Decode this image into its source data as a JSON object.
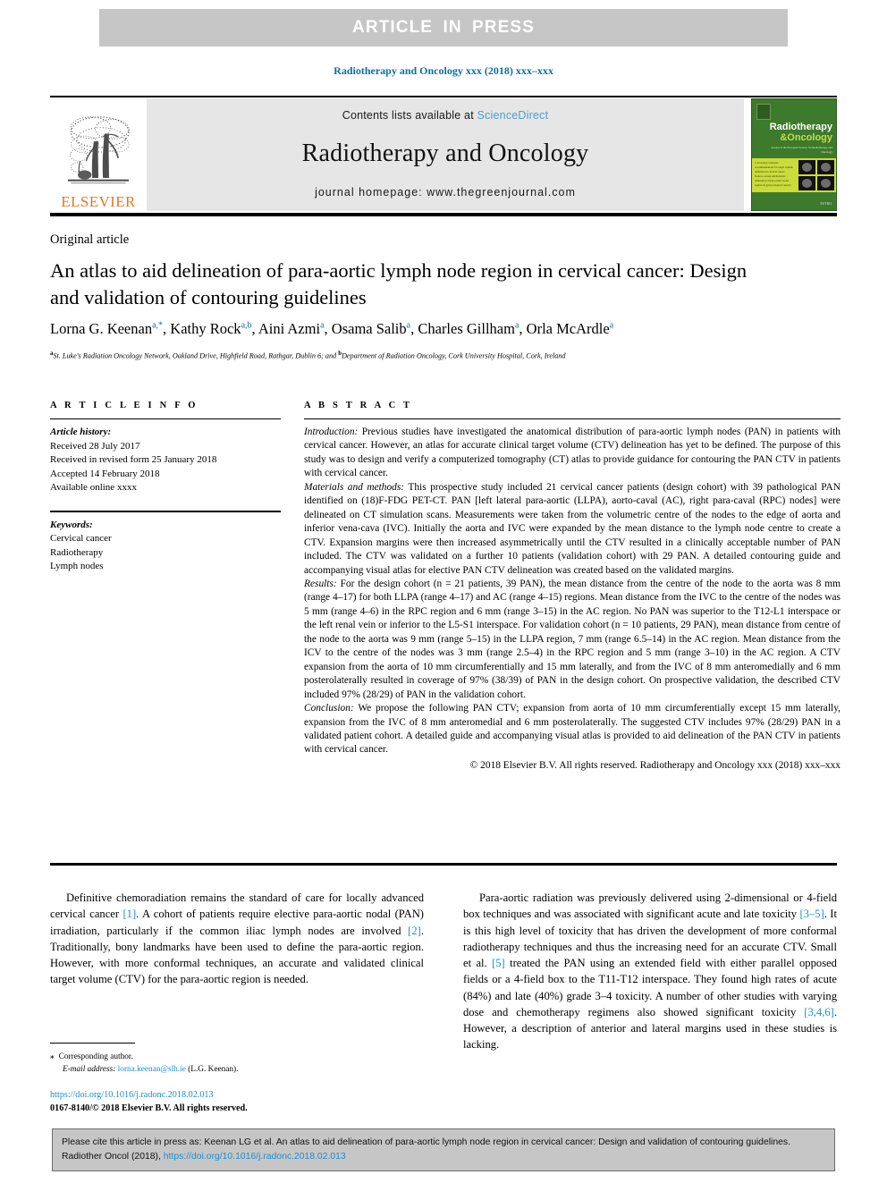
{
  "banner": {
    "text": "ARTICLE IN PRESS"
  },
  "journal_ref": "Radiotherapy and Oncology xxx (2018) xxx–xxx",
  "masthead": {
    "contents_prefix": "Contents lists available at ",
    "sciencedirect": "ScienceDirect",
    "journal_title": "Radiotherapy and Oncology",
    "homepage": "journal homepage: www.thegreenjournal.com",
    "publisher": "ELSEVIER",
    "cover": {
      "title_line1": "Radiotherapy",
      "title_line2": "&Oncology",
      "subtitle": "Journal of the European Society for Radiotherapy and Oncology",
      "band_text_1": "Contouring consensus recommendations for target volume definition in cervical cancer",
      "band_text_2": "Node-to-vessel subdivisions: delineation of para-aortic nodal regions in gynaecological cancers",
      "footer": "ESTRO"
    }
  },
  "article": {
    "type": "Original article",
    "title": "An atlas to aid delineation of para-aortic lymph node region in cervical cancer: Design and validation of contouring guidelines",
    "authors": [
      {
        "name": "Lorna G. Keenan",
        "sup": "a,*"
      },
      {
        "name": "Kathy Rock",
        "sup": "a,b"
      },
      {
        "name": "Aini Azmi",
        "sup": "a"
      },
      {
        "name": "Osama Salib",
        "sup": "a"
      },
      {
        "name": "Charles Gillham",
        "sup": "a"
      },
      {
        "name": "Orla McArdle",
        "sup": "a"
      }
    ],
    "affiliation_a": "St. Luke's Radiation Oncology Network, Oakland Drive, Highfield Road, Rathgar, Dublin 6; and ",
    "affiliation_b": "Department of Radiation Oncology, Cork University Hospital, Cork, Ireland"
  },
  "info": {
    "heading": "A R T I C L E   I N F O",
    "history_label": "Article history:",
    "history": [
      "Received 28 July 2017",
      "Received in revised form 25 January 2018",
      "Accepted 14 February 2018",
      "Available online xxxx"
    ],
    "keywords_label": "Keywords:",
    "keywords": [
      "Cervical cancer",
      "Radiotherapy",
      "Lymph nodes"
    ]
  },
  "abstract": {
    "heading": "A B S T R A C T",
    "sections": [
      {
        "label": "Introduction:",
        "text": " Previous studies have investigated the anatomical distribution of para-aortic lymph nodes (PAN) in patients with cervical cancer. However, an atlas for accurate clinical target volume (CTV) delineation has yet to be defined. The purpose of this study was to design and verify a computerized tomography (CT) atlas to provide guidance for contouring the PAN CTV in patients with cervical cancer."
      },
      {
        "label": "Materials and methods:",
        "text": " This prospective study included 21 cervical cancer patients (design cohort) with 39 pathological PAN identified on (18)F-FDG PET-CT. PAN [left lateral para-aortic (LLPA), aorto-caval (AC), right para-caval (RPC) nodes] were delineated on CT simulation scans. Measurements were taken from the volumetric centre of the nodes to the edge of aorta and inferior vena-cava (IVC). Initially the aorta and IVC were expanded by the mean distance to the lymph node centre to create a CTV. Expansion margins were then increased asymmetrically until the CTV resulted in a clinically acceptable number of PAN included. The CTV was validated on a further 10 patients (validation cohort) with 29 PAN. A detailed contouring guide and accompanying visual atlas for elective PAN CTV delineation was created based on the validated margins."
      },
      {
        "label": "Results:",
        "text": " For the design cohort (n = 21 patients, 39 PAN), the mean distance from the centre of the node to the aorta was 8 mm (range 4–17) for both LLPA (range 4–17) and AC (range 4–15) regions. Mean distance from the IVC to the centre of the nodes was 5 mm (range 4–6) in the RPC region and 6 mm (range 3–15) in the AC region. No PAN was superior to the T12-L1 interspace or the left renal vein or inferior to the L5-S1 interspace. For validation cohort (n = 10 patients, 29 PAN), mean distance from centre of the node to the aorta was 9 mm (range 5–15) in the LLPA region, 7 mm (range 6.5–14) in the AC region. Mean distance from the ICV to the centre of the nodes was 3 mm (range 2.5–4) in the RPC region and 5 mm (range 3–10) in the AC region. A CTV expansion from the aorta of 10 mm circumferentially and 15 mm laterally, and from the IVC of 8 mm anteromedially and 6 mm posterolaterally resulted in coverage of 97% (38/39) of PAN in the design cohort. On prospective validation, the described CTV included 97% (28/29) of PAN in the validation cohort."
      },
      {
        "label": "Conclusion:",
        "text": " We propose the following PAN CTV; expansion from aorta of 10 mm circumferentially except 15 mm laterally, expansion from the IVC of 8 mm anteromedial and 6 mm posterolaterally. The suggested CTV includes 97% (28/29) PAN in a validated patient cohort. A detailed guide and accompanying visual atlas is provided to aid delineation of the PAN CTV in patients with cervical cancer."
      }
    ],
    "copyright": "© 2018 Elsevier B.V. All rights reserved. Radiotherapy and Oncology xxx (2018) xxx–xxx"
  },
  "body": {
    "left_parts": [
      "Definitive chemoradiation remains the standard of care for locally advanced cervical cancer ",
      "[1]",
      ". A cohort of patients require elective para-aortic nodal (PAN) irradiation, particularly if the common iliac lymph nodes are involved ",
      "[2]",
      ". Traditionally, bony landmarks have been used to define the para-aortic region. However, with more conformal techniques, an accurate and validated clinical target volume (CTV) for the para-aortic region is needed."
    ],
    "right_parts": [
      "Para-aortic radiation was previously delivered using 2-dimensional or 4-field box techniques and was associated with significant acute and late toxicity ",
      "[3–5]",
      ". It is this high level of toxicity that has driven the development of more conformal radiotherapy techniques and thus the increasing need for an accurate CTV. Small et al. ",
      "[5]",
      " treated the PAN using an extended field with either parallel opposed fields or a 4-field box to the T11-T12 interspace. They found high rates of acute (84%) and late (40%) grade 3–4 toxicity. A number of other studies with varying dose and chemotherapy regimens also showed significant toxicity ",
      "[3,4,6]",
      ". However, a description of anterior and lateral margins used in these studies is lacking."
    ]
  },
  "footnote": {
    "star": "⁎",
    "corresponding": "Corresponding author.",
    "email_label": "E-mail address:",
    "email": "lorna.keenan@slh.ie",
    "email_suffix": " (L.G. Keenan).",
    "doi": "https://doi.org/10.1016/j.radonc.2018.02.013",
    "issn_line": "0167-8140/© 2018 Elsevier B.V. All rights reserved."
  },
  "cite_box": {
    "prefix": "Please cite this article in press as: Keenan LG et al. An atlas to aid delineation of para-aortic lymph node region in cervical cancer: Design and validation of contouring guidelines. Radiother Oncol (2018), ",
    "link": "https://doi.org/10.1016/j.radonc.2018.02.013"
  },
  "colors": {
    "banner_bg": "#c6c6c6",
    "link_blue": "#1b8fd0",
    "journal_blue": "#0b6ea8",
    "elsevier_orange": "#e87722",
    "cover_green": "#3d7a2b",
    "cover_band": "#cadb3c"
  }
}
